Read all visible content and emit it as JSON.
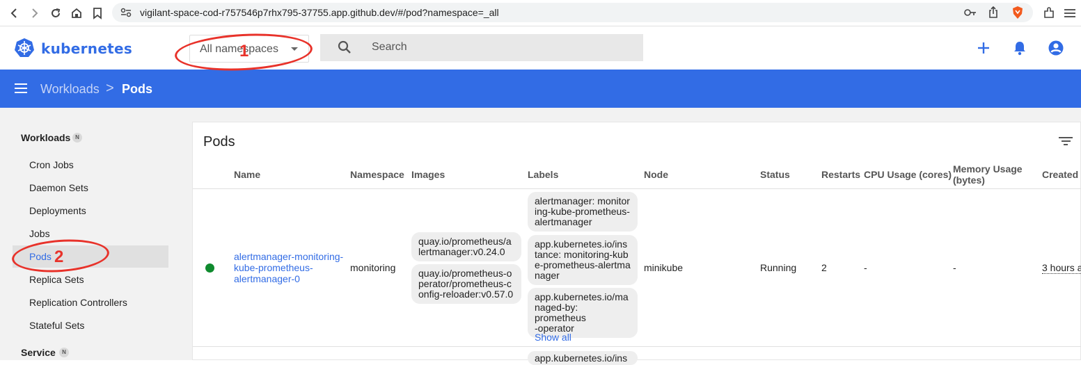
{
  "browser": {
    "url": "vigilant-space-cod-r757546p7rhx795-37755.app.github.dev/#/pod?namespace=_all"
  },
  "header": {
    "brand": "kubernetes",
    "namespace_select": "All namespaces",
    "search_placeholder": "Search"
  },
  "breadcrumb": {
    "parent": "Workloads",
    "separator": ">",
    "current": "Pods"
  },
  "sidebar": {
    "sections": [
      {
        "title": "Workloads",
        "badge": "N",
        "items": [
          "Cron Jobs",
          "Daemon Sets",
          "Deployments",
          "Jobs",
          "Pods",
          "Replica Sets",
          "Replication Controllers",
          "Stateful Sets"
        ]
      },
      {
        "title": "Service",
        "badge": "N"
      }
    ],
    "selected": "Pods"
  },
  "table": {
    "title": "Pods",
    "columns": [
      "Name",
      "Namespace",
      "Images",
      "Labels",
      "Node",
      "Status",
      "Restarts",
      "CPU Usage (cores)",
      "Memory Usage (bytes)",
      "Created"
    ],
    "column_lines": {
      "cpu": "CPU Usage (cores)",
      "memory_1": "Memory Usage",
      "memory_2": "(bytes)"
    },
    "rows": [
      {
        "status_color": "#0f8a2e",
        "name_lines": [
          "alertmanager-monitoring-",
          "kube-prometheus-",
          "alertmanager-0"
        ],
        "namespace": "monitoring",
        "images": [
          [
            "quay.io/prometheus/a",
            "lertmanager:v0.24.0"
          ],
          [
            "quay.io/prometheus-o",
            "perator/prometheus-c",
            "onfig-reloader:v0.57.0"
          ]
        ],
        "labels": [
          [
            "alertmanager: monitor",
            "ing-kube-prometheus-",
            "alertmanager"
          ],
          [
            "app.kubernetes.io/ins",
            "tance: monitoring-kub",
            "e-prometheus-alertma",
            "nager"
          ],
          [
            "app.kubernetes.io/ma",
            "naged-by: prometheus",
            "-operator"
          ]
        ],
        "show_all": "Show all",
        "node": "minikube",
        "status": "Running",
        "restarts": "2",
        "cpu": "-",
        "memory": "-",
        "created": "3 hours a"
      }
    ],
    "next_row_label_partial": "app.kubernetes.io/ins"
  },
  "annotations": [
    {
      "number": "1",
      "color": "#e8322a"
    },
    {
      "number": "2",
      "color": "#e8322a"
    }
  ],
  "colors": {
    "brand_blue": "#326ce5",
    "link_blue": "#326ce5",
    "annotation_red": "#e8322a"
  }
}
